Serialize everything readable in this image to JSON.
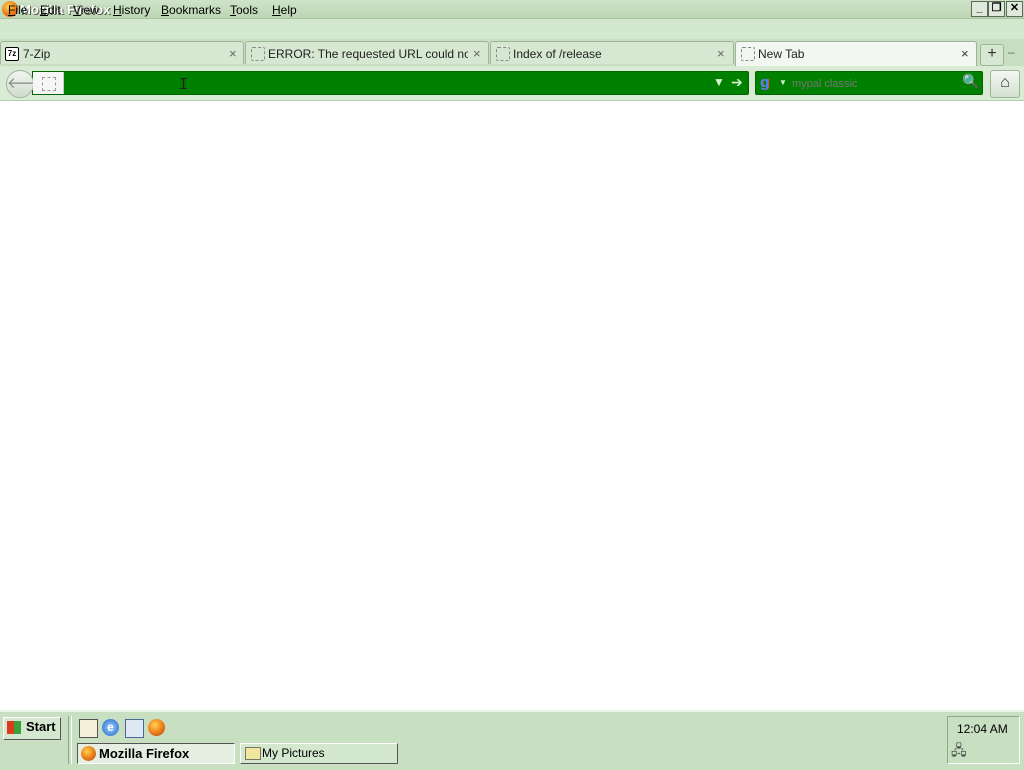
{
  "window": {
    "title": "Mozilla Firefox",
    "controls": {
      "minimize": "_",
      "maximize": "❐",
      "close": "✕"
    }
  },
  "menu": [
    {
      "label": "File",
      "accel": "F",
      "rest": "ile"
    },
    {
      "label": "Edit",
      "accel": "E",
      "rest": "dit"
    },
    {
      "label": "View",
      "accel": "V",
      "rest": "iew"
    },
    {
      "label": "History",
      "accel": "H",
      "rest": "istory"
    },
    {
      "label": "Bookmarks",
      "accel": "B",
      "rest": "ookmarks"
    },
    {
      "label": "Tools",
      "accel": "T",
      "rest": "ools"
    },
    {
      "label": "Help",
      "accel": "H",
      "rest": "elp"
    }
  ],
  "tabs": [
    {
      "title": "7-Zip",
      "favicon": "7z",
      "active": false
    },
    {
      "title": "ERROR: The requested URL could not b...",
      "active": false
    },
    {
      "title": "Index of /release",
      "active": false
    },
    {
      "title": "New Tab",
      "active": true
    }
  ],
  "tab_close_glyph": "×",
  "new_tab_glyph": "+",
  "tab_list_glyph": "–",
  "navbar": {
    "back_glyph": "🡐",
    "url_value": "",
    "url_dropdown_glyph": "▼",
    "url_go_glyph": "➔",
    "search_engine_glyph": "g",
    "search_engine_caret": "▼",
    "search_placeholder": "mypal classic",
    "search_go_glyph": "🔍",
    "home_glyph": "⌂",
    "urlbar_color": "#008000"
  },
  "taskbar": {
    "start_label": "Start",
    "tasks": [
      {
        "label": "Mozilla Firefox",
        "pressed": true
      },
      {
        "label": "My Pictures",
        "pressed": false
      }
    ],
    "clock": "12:04 AM"
  }
}
